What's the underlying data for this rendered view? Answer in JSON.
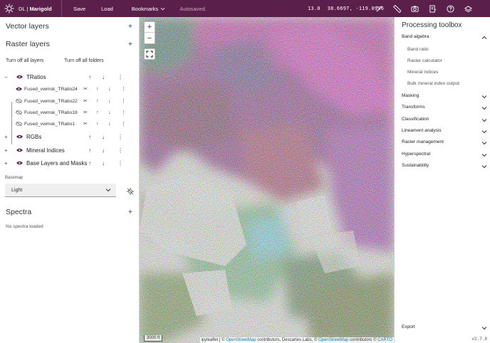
{
  "topbar": {
    "brand_prefix": "DL",
    "brand_sep": " | ",
    "brand_name": "Marigold",
    "save": "Save",
    "load": "Load",
    "bookmarks": "Bookmarks",
    "autosaved": "Autosaved.",
    "zoom": "13.0",
    "coords": "38.6697, -119.0996",
    "icons": [
      "magic-wand-icon",
      "ruler-icon",
      "camera-icon",
      "notebook-icon",
      "help-icon",
      "layers-stack-icon"
    ],
    "bg_color": "#5a1f4a"
  },
  "left": {
    "vector_layers": "Vector layers",
    "raster_layers": "Raster layers",
    "turn_off_layers": "Turn off all layers",
    "turn_off_folders": "Turn off all folders",
    "groups": [
      {
        "label": "TRatios",
        "toggle": "−",
        "expanded": true
      },
      {
        "label": "RGBs",
        "toggle": "+"
      },
      {
        "label": "Mineral Indices",
        "toggle": "+"
      },
      {
        "label": "Base Layers and Masks",
        "toggle": "+"
      }
    ],
    "sublayers": [
      {
        "label": "Fused_vwmsk_TRatio24"
      },
      {
        "label": "Fused_vwmsk_TRatio22"
      },
      {
        "label": "Fused_vwmsk_TRatio18"
      },
      {
        "label": "Fused_vwmsk_TRatio1"
      }
    ],
    "basemap_label": "Basemap",
    "basemap_value": "Light",
    "spectra": "Spectra",
    "no_spectra": "No spectra loaded",
    "eye_color": "#5a1f4a"
  },
  "map": {
    "zoom_in": "+",
    "zoom_out": "−",
    "scale": "3000 ft",
    "attrib_prefix": "ipyleaflet | © ",
    "osm1": "OpenStreetMap",
    "attrib_mid": " contributors, Descartes Labs, © ",
    "osm2": "OpenStreetMap",
    "attrib_mid2": " contributors © ",
    "carto": "CARTO"
  },
  "right": {
    "title": "Processing toolbox",
    "band_algebra": "Band algebra",
    "band_items": [
      "Band ratio",
      "Raster calculator",
      "Mineral indices",
      "Bulk mineral index output"
    ],
    "sections": [
      "Masking",
      "Transforms",
      "Classification",
      "Lineament analysis",
      "Raster management",
      "Hyperspectral",
      "Sustainability"
    ],
    "export": "Export",
    "version": "v2.7.0"
  }
}
